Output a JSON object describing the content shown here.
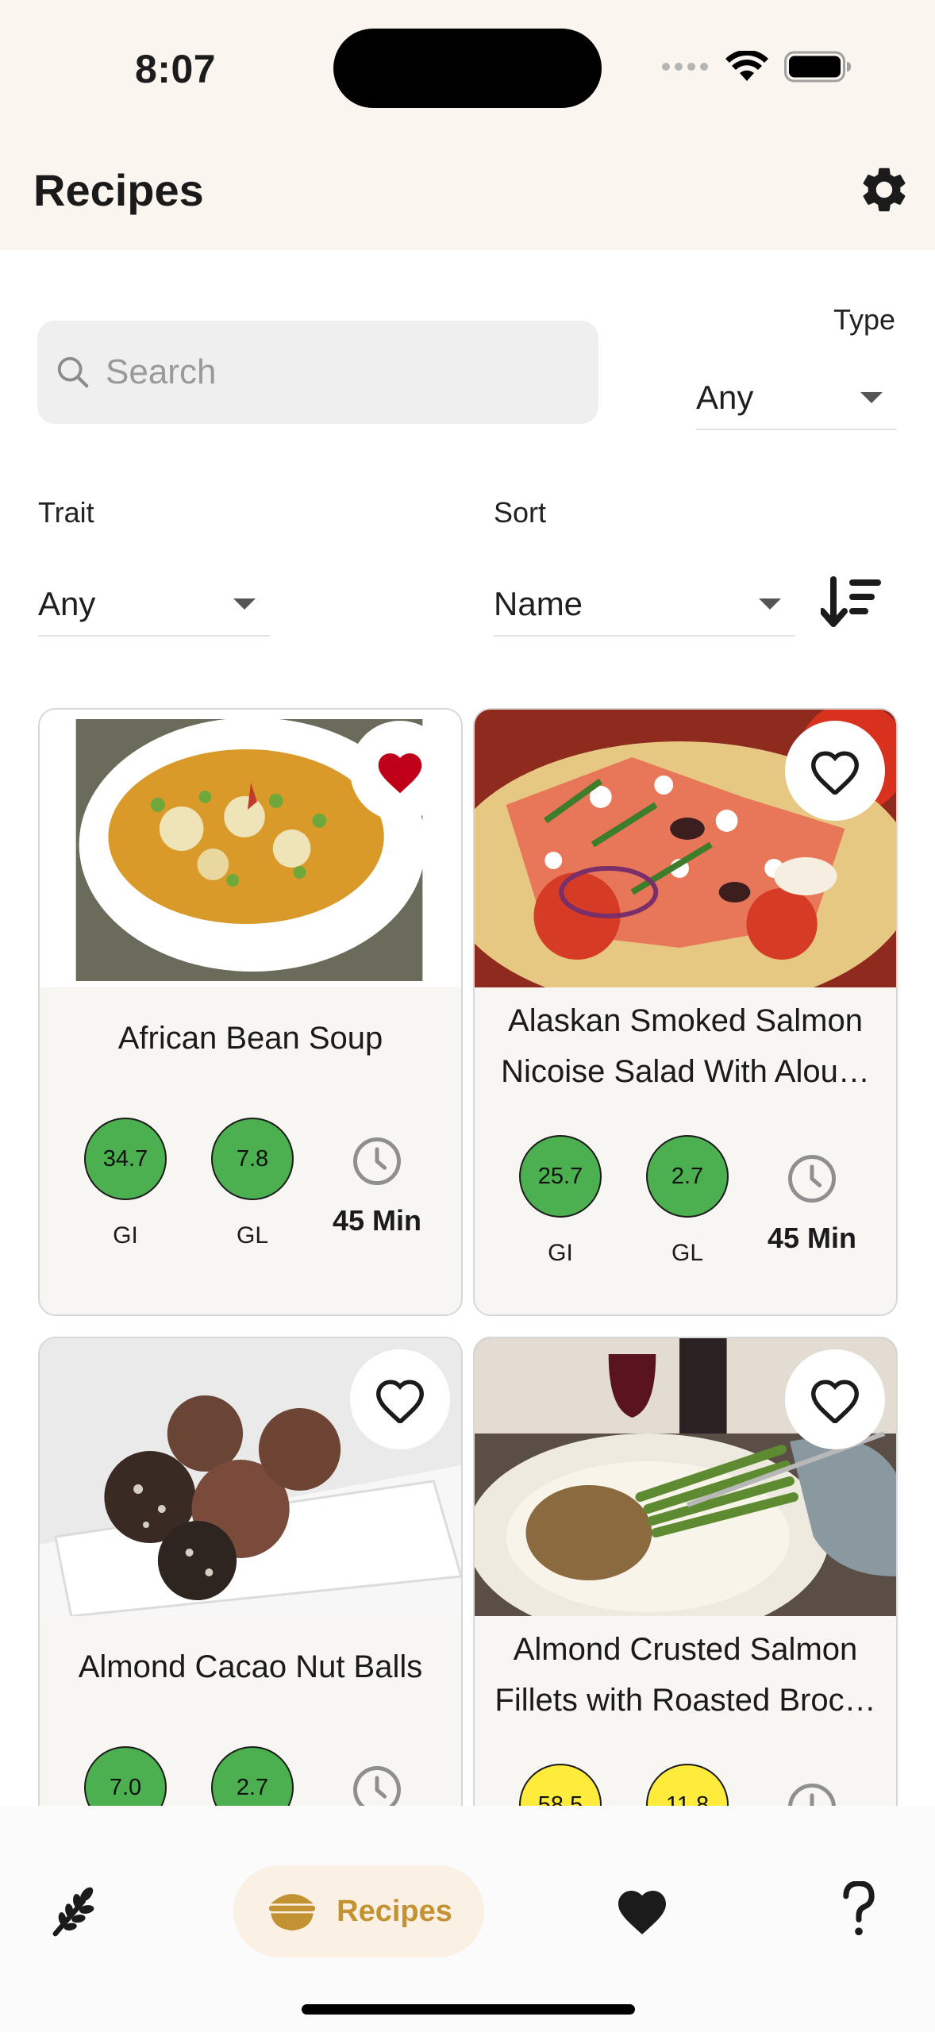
{
  "status_bar": {
    "time": "8:07"
  },
  "header": {
    "title": "Recipes"
  },
  "filters": {
    "search_placeholder": "Search",
    "type": {
      "label": "Type",
      "value": "Any"
    },
    "trait": {
      "label": "Trait",
      "value": "Any"
    },
    "sort": {
      "label": "Sort",
      "value": "Name"
    }
  },
  "recipes": [
    {
      "name": "African Bean Soup",
      "gi": "34.7",
      "gl": "7.8",
      "gi_label": "GI",
      "gl_label": "GL",
      "time": "45 Min",
      "favorite": true,
      "gi_color": "#4caf50",
      "gl_color": "#4caf50"
    },
    {
      "name": "Alaskan Smoked Salmon Nicoise Salad With Alou…",
      "name_line1": "Alaskan Smoked Salmon",
      "name_line2": "Nicoise Salad With Alou…",
      "gi": "25.7",
      "gl": "2.7",
      "gi_label": "GI",
      "gl_label": "GL",
      "time": "45 Min",
      "favorite": false,
      "gi_color": "#4caf50",
      "gl_color": "#4caf50"
    },
    {
      "name": "Almond Cacao Nut Balls",
      "gi": "7.0",
      "gl": "2.7",
      "favorite": false,
      "gi_color": "#4caf50",
      "gl_color": "#4caf50"
    },
    {
      "name": "Almond Crusted Salmon Fillets with Roasted Broc…",
      "name_line1": "Almond Crusted Salmon",
      "name_line2": "Fillets with Roasted Broc…",
      "gi": "58.5",
      "gl": "11.8",
      "favorite": false,
      "gi_color": "#ffeb3b",
      "gl_color": "#ffeb3b"
    }
  ],
  "bottom_nav": {
    "items": [
      {
        "icon": "grain-icon"
      },
      {
        "icon": "bowl-icon",
        "label": "Recipes",
        "active": true
      },
      {
        "icon": "heart-icon"
      },
      {
        "icon": "help-icon"
      }
    ]
  },
  "colors": {
    "accent": "#c39232",
    "header_bg": "#faf6ef",
    "favorite_red": "#c0001a",
    "gi_green": "#4caf50",
    "gi_yellow": "#ffeb3b"
  }
}
